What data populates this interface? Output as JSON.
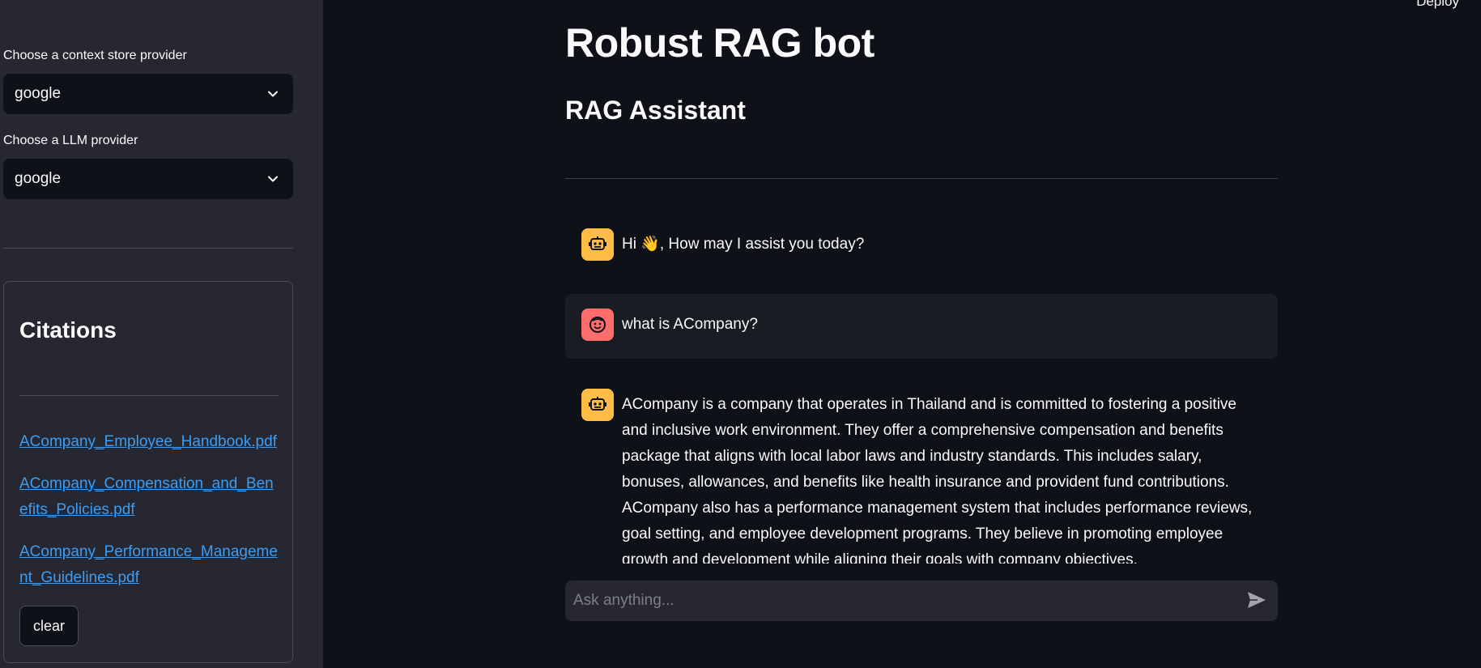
{
  "header": {
    "deploy_label": "Deploy"
  },
  "sidebar": {
    "context_store": {
      "label": "Choose a context store provider",
      "value": "google"
    },
    "llm_provider": {
      "label": "Choose a LLM provider",
      "value": "google"
    },
    "citations": {
      "title": "Citations",
      "links": [
        "ACompany_Employee_Handbook.pdf",
        "ACompany_Compensation_and_Benefits_Policies.pdf",
        "ACompany_Performance_Management_Guidelines.pdf"
      ],
      "clear_label": "clear"
    }
  },
  "main": {
    "title": "Robust RAG bot",
    "subtitle": "RAG Assistant",
    "messages": [
      {
        "role": "assistant",
        "avatar_icon": "robot-icon",
        "text": "Hi 👋, How may I assist you today?"
      },
      {
        "role": "user",
        "avatar_icon": "smiley-face-icon",
        "text": "what is ACompany?"
      },
      {
        "role": "assistant",
        "avatar_icon": "robot-icon",
        "text": "ACompany is a company that operates in Thailand and is committed to fostering a positive and inclusive work environment. They offer a comprehensive compensation and benefits package that aligns with local labor laws and industry standards. This includes salary, bonuses, allowances, and benefits like health insurance and provident fund contributions. ACompany also has a performance management system that includes performance reviews, goal setting, and employee development programs. They believe in promoting employee growth and development while aligning their goals with company objectives."
      }
    ],
    "chat_input": {
      "placeholder": "Ask anything...",
      "value": ""
    }
  },
  "colors": {
    "sidebar_bg": "#262730",
    "main_bg": "#0e1117",
    "link": "#3d9df3",
    "bot_avatar": "#ffbd45",
    "user_avatar": "#ff6c6c"
  }
}
